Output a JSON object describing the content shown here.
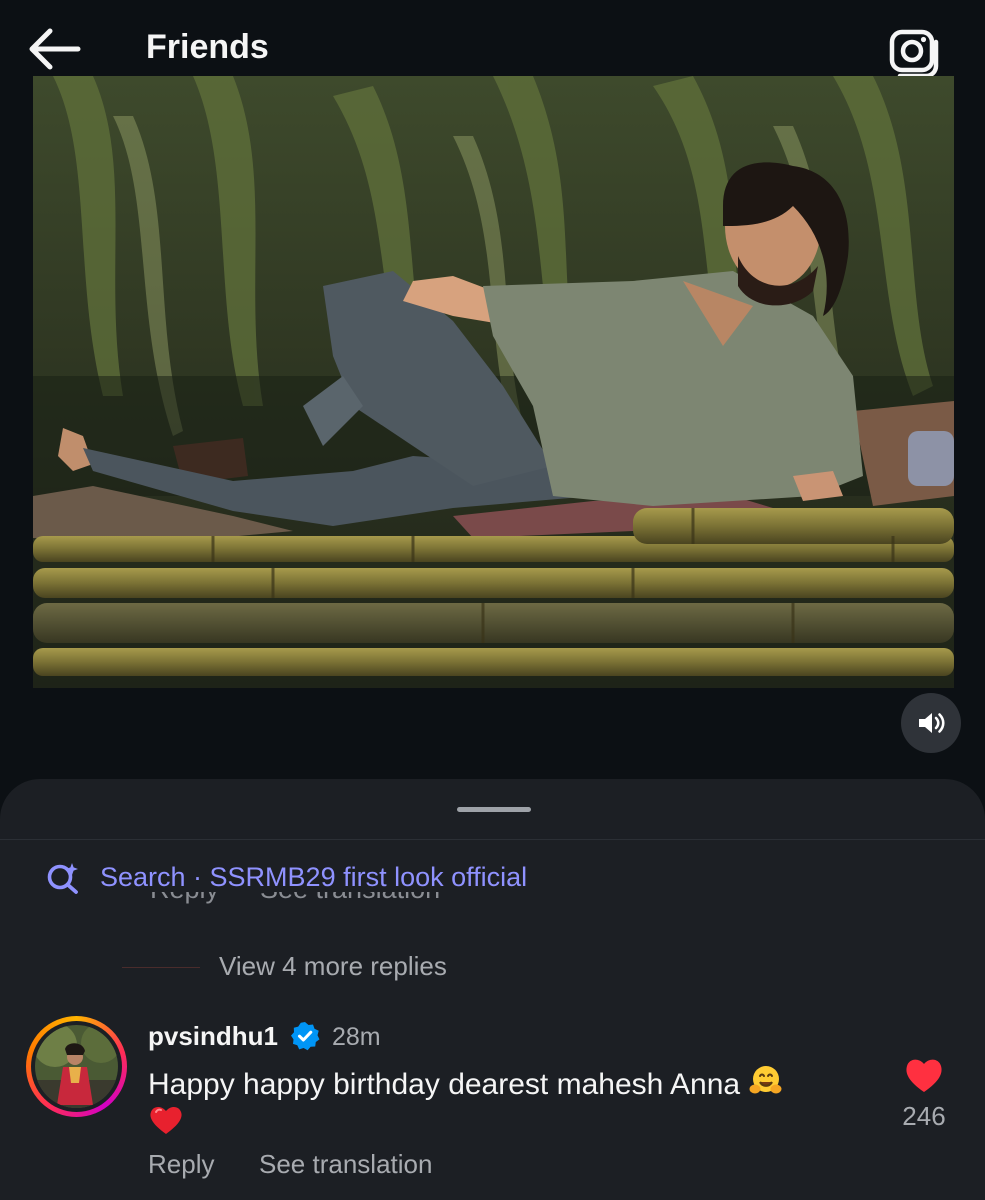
{
  "header": {
    "title": "Friends",
    "back_icon": "arrow-left-icon",
    "camera_icon": "camera-icon"
  },
  "media": {
    "sound_icon": "speaker-icon"
  },
  "comments": {
    "search_label": "Search · SSRMB29 first look official",
    "clipped_reply": "Reply",
    "clipped_translation": "See translation",
    "view_more_replies": "View 4 more replies",
    "comment": {
      "username": "pvsindhu1",
      "verified": true,
      "time": "28m",
      "text": "Happy happy birthday dearest mahesh Anna",
      "like_count": "246",
      "reply_label": "Reply",
      "translation_label": "See translation"
    }
  },
  "colors": {
    "background": "#0c1014",
    "sheet": "#1c1f24",
    "search_accent": "#8f92ff",
    "like_red": "#ff3040",
    "verified_blue": "#0095f6"
  }
}
